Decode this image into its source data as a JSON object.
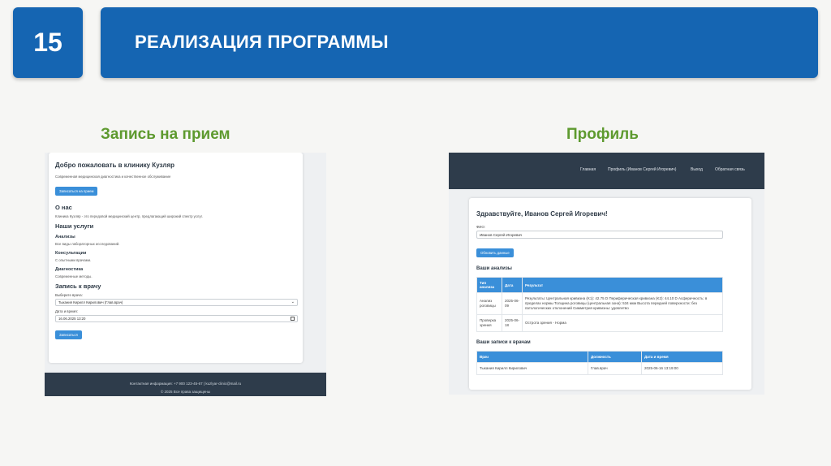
{
  "slide": {
    "number": "15",
    "title": "РЕАЛИЗАЦИЯ ПРОГРАММЫ",
    "caption_left": "Запись на прием",
    "caption_right": "Профиль"
  },
  "appointment": {
    "welcome": "Добро пожаловать в клинику Кузляр",
    "tagline": "Современная медицинская диагностика и качественное обслуживание",
    "book_button": "Записаться на прием",
    "about_title": "О нас",
    "about_text": "Клиника Кузляр - это передовой медицинский центр, предлагающий широкий спектр услуг.",
    "services_title": "Наши услуги",
    "services": [
      {
        "name": "Анализы",
        "desc": "Все виды лабораторных исследований."
      },
      {
        "name": "Консультации",
        "desc": "С опытными врачами."
      },
      {
        "name": "Диагностика",
        "desc": "Современные методы."
      }
    ],
    "booking_title": "Запись к врачу",
    "doctor_label": "Выберите врача:",
    "doctor_value": "Тыкания Кирилл Кирилович (Глав.врач)",
    "datetime_label": "Дата и время:",
    "datetime_value": "16.06.2025 13:20",
    "submit_button": "Записаться",
    "footer_contacts": "Контактная информация: +7 900 123-45-67 | kuzlyar-clinic@mail.ru",
    "footer_copyright": "© 2025 Все права защищены"
  },
  "profile": {
    "nav": [
      "Главная",
      "Профиль (Иванов Сергей Игоревич)",
      "Выход",
      "Обратная связь"
    ],
    "greeting": "Здравствуйте, Иванов Сергей Игоревич!",
    "fio_label": "ФИО:",
    "fio_value": "Иванов Сергей Игоревич",
    "update_button": "Обновить данные",
    "analyses_title": "Ваши анализы",
    "analyses_headers": [
      "Тип анализа",
      "Дата",
      "Результат"
    ],
    "analyses_rows": [
      [
        "Анализ роговицы",
        "2025-06-09",
        "Результаты: Центральная кривизна (K1): 42.75 D Периферическая кривизна (K2): 44.10 D Асферичность: в пределах нормы Толщина роговицы (центральная зона): 534 мкм Высота передней поверхности: без патологических отклонений Симметрия кривизны: удовлетво"
      ],
      [
        "Проверка зрения",
        "2025-06-18",
        "Острота зрения - Норма"
      ]
    ],
    "appointments_title": "Ваши записи к врачам",
    "appointments_headers": [
      "Врач",
      "Должность",
      "Дата и время"
    ],
    "appointments_rows": [
      [
        "Тыкания Кирилл Кирилович",
        "Глав.врач",
        "2025-06-16 13:19:00"
      ]
    ]
  }
}
